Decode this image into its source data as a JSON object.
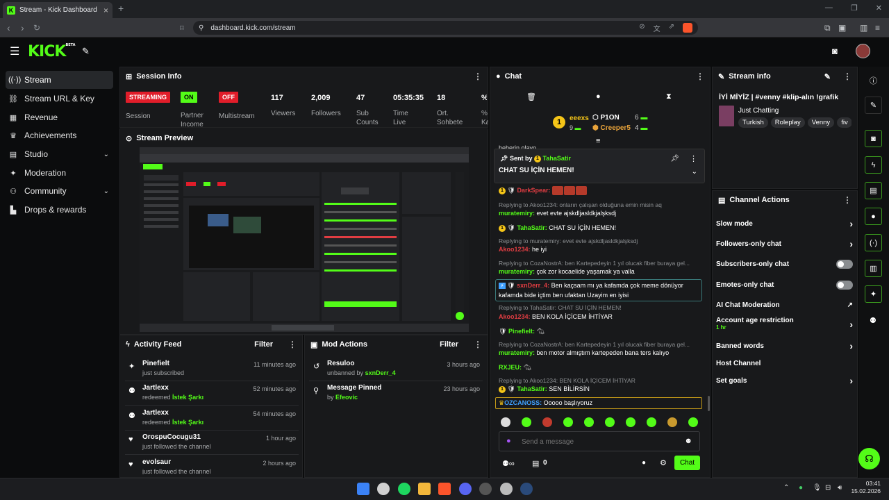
{
  "browser": {
    "tab_title": "Stream - Kick Dashboard",
    "url": "dashboard.kick.com/stream"
  },
  "sidebar": {
    "items": [
      {
        "label": "Stream",
        "icon": "broadcast-icon"
      },
      {
        "label": "Stream URL & Key",
        "icon": "link-icon"
      },
      {
        "label": "Revenue",
        "icon": "dollar-icon"
      },
      {
        "label": "Achievements",
        "icon": "trophy-icon"
      },
      {
        "label": "Studio",
        "icon": "studio-icon"
      },
      {
        "label": "Moderation",
        "icon": "wrench-icon"
      },
      {
        "label": "Community",
        "icon": "people-icon"
      },
      {
        "label": "Drops & rewards",
        "icon": "chart-icon"
      }
    ]
  },
  "session": {
    "title": "Session Info",
    "metrics": [
      {
        "value": "STREAMING",
        "label": "Session"
      },
      {
        "value": "ON",
        "label": "Partner Income"
      },
      {
        "value": "OFF",
        "label": "Multistream"
      },
      {
        "value": "117",
        "label": "Viewers"
      },
      {
        "value": "2,009",
        "label": "Followers"
      },
      {
        "value": "47",
        "label": "Sub Counts"
      },
      {
        "value": "05:35:35",
        "label": "Time Live"
      },
      {
        "value": "18",
        "label": "Ort. Sohbete"
      },
      {
        "value": "%",
        "label": "%\nKa"
      }
    ]
  },
  "preview": {
    "title": "Stream Preview"
  },
  "activity": {
    "title": "Activity Feed",
    "filter": "Filter",
    "items": [
      {
        "name": "Pinefielt",
        "sub": "just subscribed",
        "extra": "",
        "time": "11 minutes ago"
      },
      {
        "name": "Jartlexx",
        "sub": "redeemed",
        "extra": "İstek Şarkı",
        "time": "52 minutes ago"
      },
      {
        "name": "Jartlexx",
        "sub": "redeemed",
        "extra": "İstek Şarkı",
        "time": "54 minutes ago"
      },
      {
        "name": "OrospuCocugu31",
        "sub": "just followed the channel",
        "extra": "",
        "time": "1 hour ago"
      },
      {
        "name": "evolsaur",
        "sub": "just followed the channel",
        "extra": "",
        "time": "2 hours ago"
      }
    ]
  },
  "mod": {
    "title": "Mod Actions",
    "filter": "Filter",
    "items": [
      {
        "name": "Resuloo",
        "sub": "unbanned by",
        "by": "sxnDerr_4",
        "time": "3 hours ago"
      },
      {
        "name": "Message Pinned",
        "sub": "by",
        "by": "Efeovic",
        "time": "23 hours ago"
      }
    ]
  },
  "chat": {
    "title": "Chat",
    "leaders": {
      "first": "eeexs",
      "first_count": "9",
      "second": "P1ON",
      "second_count": "6",
      "third": "Creeper5",
      "third_count": "4"
    },
    "pinned": {
      "sent_by": "Sent by",
      "user": "TahaSatir",
      "message": "CHAT SU İÇİN HEMEN!"
    },
    "partial_top": "heberin olayo",
    "messages": [
      {
        "reply": "",
        "user": "DarkSpear:",
        "text": "",
        "color": "r"
      },
      {
        "reply": "Replying to Akoo1234: onların çalışan olduğuna emin misin aq",
        "user": "muratemiry:",
        "text": "evet evte ajskdljasldkjalşksdj",
        "color": "g"
      },
      {
        "reply": "",
        "user": "TahaSatir:",
        "text": "CHAT SU İÇİN HEMEN!",
        "color": "g"
      },
      {
        "reply": "Replying to muratemiry: evet evte ajskdljasldkjalşksdj",
        "user": "Akoo1234:",
        "text": "he iyi",
        "color": "r"
      },
      {
        "reply": "Replying to CozaNostrA: ben Kartepedeyin 1 yıl olucak fiber buraya gel...",
        "user": "muratemiry:",
        "text": "çok zor kocaelide yaşamak ya valla",
        "color": "g"
      },
      {
        "reply": "",
        "user": "sxnDerr_4:",
        "text": "Ben kaçsam mı ya kafamda çok meme dönüyor",
        "text2": "kafamda bide içtim ben ufaktan Uzayim en iyisi",
        "color": "r"
      },
      {
        "reply": "Replying to TahaSatir: CHAT SU İÇİN HEMEN!",
        "user": "Akoo1234:",
        "text": "BEN KOLA İÇİCEM İHTİYAR",
        "color": "r"
      },
      {
        "reply": "",
        "user": "Pinefielt:",
        "text": "",
        "color": "g"
      },
      {
        "reply": "Replying to CozaNostrA: ben Kartepedeyin 1 yıl olucak fiber buraya gel...",
        "user": "muratemiry:",
        "text": "ben motor almıştım kartepeden bana ters kalıyo",
        "color": "g"
      },
      {
        "reply": "",
        "user": "RXJEU:",
        "text": "",
        "color": "g"
      },
      {
        "reply": "Replying to Akoo1234: BEN KOLA İÇİCEM İHTİYAR",
        "user": "TahaSatir:",
        "text": "SEN BİLİRSİN",
        "color": "g"
      },
      {
        "reply": "",
        "user": "OZCANOSS:",
        "text": "Ooooo başlıyoruz",
        "color": "b"
      }
    ],
    "placeholder": "Send a message",
    "count": "0",
    "chat_button": "Chat"
  },
  "streaminfo": {
    "title": "Stream info",
    "stream_title": "İYİ MİYİZ | #venny #klip-alın !grafik",
    "category": "Just Chatting",
    "tags": [
      "Turkish",
      "Roleplay",
      "Venny",
      "fiv"
    ]
  },
  "channel_actions": {
    "title": "Channel Actions",
    "items": [
      {
        "label": "Slow mode",
        "type": "arrow"
      },
      {
        "label": "Followers-only chat",
        "type": "arrow"
      },
      {
        "label": "Subscribers-only chat",
        "type": "toggle"
      },
      {
        "label": "Emotes-only chat",
        "type": "toggle"
      },
      {
        "label": "AI Chat Moderation",
        "type": "ext"
      },
      {
        "label": "Account age restriction",
        "sub": "1 hr",
        "type": "arrow"
      },
      {
        "label": "Banned words",
        "type": "arrow"
      },
      {
        "label": "Host Channel",
        "type": "none"
      },
      {
        "label": "Set goals",
        "type": "arrow"
      }
    ]
  },
  "taskbar": {
    "time": "03:41",
    "date": "15.02.2026"
  },
  "colors": {
    "accent": "#53fc18",
    "live_red": "#e11d2a",
    "panel": "#18191b"
  }
}
